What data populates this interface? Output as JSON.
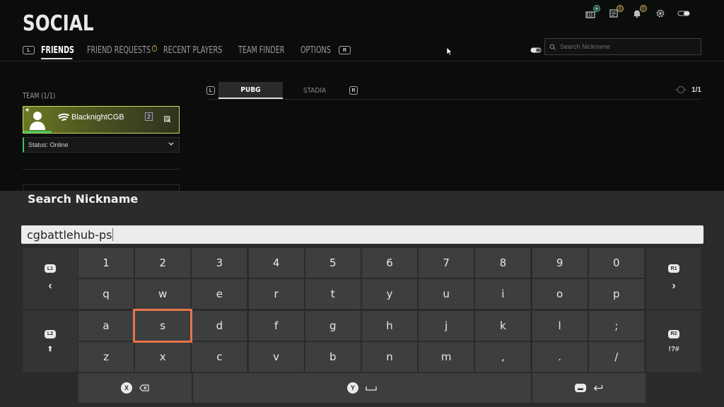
{
  "header": {
    "title": "SOCIAL",
    "left_hint": "L",
    "right_hint": "R",
    "tabs": [
      {
        "label": "FRIENDS",
        "active": true
      },
      {
        "label": "FRIEND REQUESTS",
        "badge": "!"
      },
      {
        "label": "RECENT PLAYERS"
      },
      {
        "label": "TEAM FINDER"
      },
      {
        "label": "OPTIONS"
      }
    ],
    "search_placeholder": "Search Nickname",
    "top_icons": [
      "store-icon",
      "news-icon",
      "bell-icon",
      "gear-icon",
      "toggle-icon"
    ],
    "notif_badge": "!"
  },
  "team": {
    "label": "TEAM (1/1)",
    "member": {
      "name": "BlacknightCGB",
      "level": "2",
      "star": "★"
    },
    "status": "Status: Online"
  },
  "platform_tabs": {
    "left_hint": "L",
    "right_hint": "R",
    "tabs": [
      {
        "label": "PUBG",
        "active": true
      },
      {
        "label": "STADIA"
      }
    ],
    "page_count": "1/1"
  },
  "keyboard": {
    "title": "Search Nickname",
    "input_value": "cgbattlehub-ps",
    "rows": [
      [
        "1",
        "2",
        "3",
        "4",
        "5",
        "6",
        "7",
        "8",
        "9",
        "0"
      ],
      [
        "q",
        "w",
        "e",
        "r",
        "t",
        "y",
        "u",
        "i",
        "o",
        "p"
      ],
      [
        "a",
        "s",
        "d",
        "f",
        "g",
        "h",
        "j",
        "k",
        "l",
        ";"
      ],
      [
        "z",
        "x",
        "c",
        "v",
        "b",
        "n",
        "m",
        ",",
        ".",
        "/"
      ]
    ],
    "selected_key": "s",
    "side": {
      "l1": "L1",
      "r1": "R1",
      "l2": "L2",
      "r2": "R2",
      "symbols": "!?#",
      "prev": "‹",
      "next": "›",
      "shift": "⬆"
    },
    "bottom": {
      "backspace_button": "X",
      "space_button": "Y",
      "enter_button": "▬"
    }
  }
}
